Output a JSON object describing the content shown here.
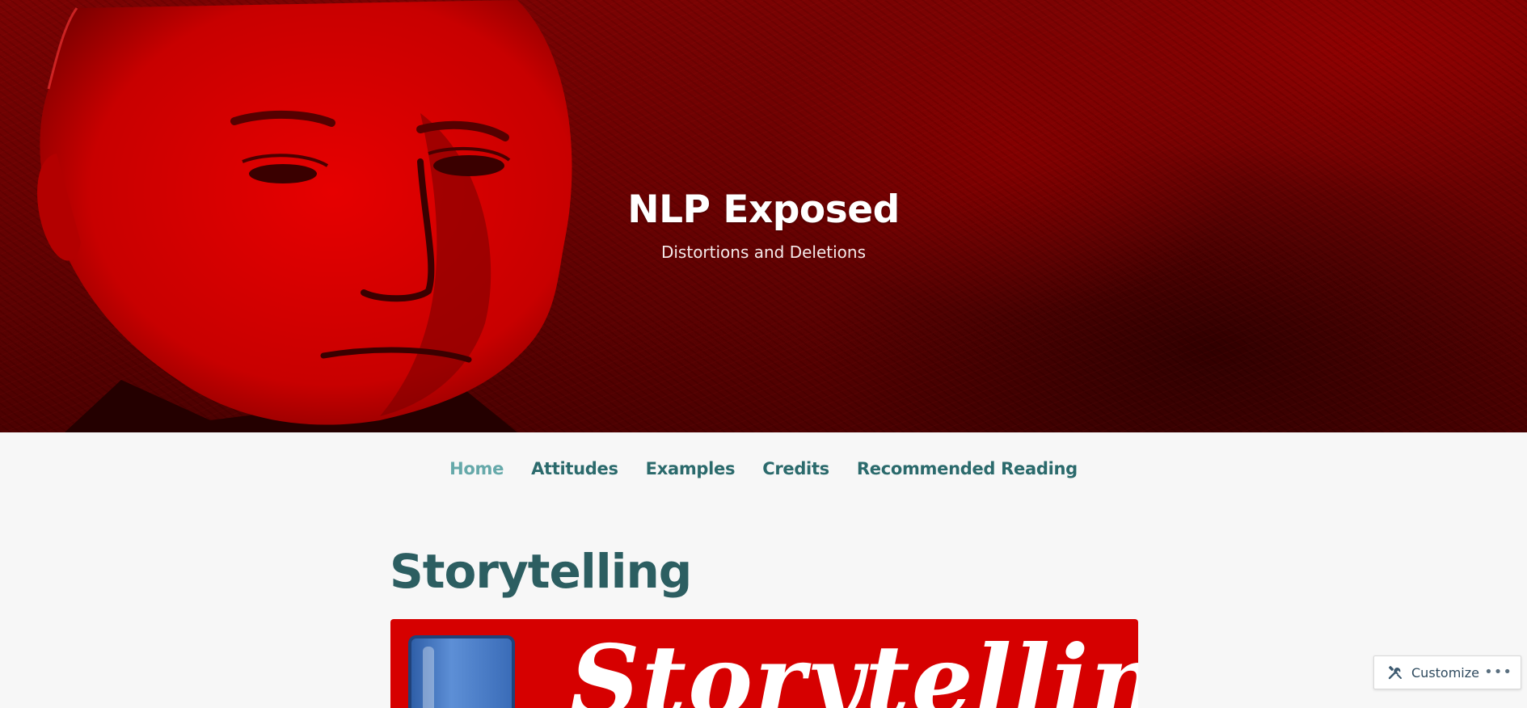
{
  "header": {
    "site_title": "NLP Exposed",
    "tagline": "Distortions and Deletions"
  },
  "nav": {
    "items": [
      {
        "label": "Home",
        "current": true
      },
      {
        "label": "Attitudes",
        "current": false
      },
      {
        "label": "Examples",
        "current": false
      },
      {
        "label": "Credits",
        "current": false
      },
      {
        "label": "Recommended Reading",
        "current": false
      }
    ]
  },
  "post": {
    "title": "Storytelling",
    "featured_image_text": "Storytelling"
  },
  "customize": {
    "label": "Customize",
    "more_label": "•••"
  },
  "colors": {
    "banner_red": "#6a0202",
    "nav_link": "#2b6a6c",
    "nav_current": "#66a9aa",
    "post_title": "#2c5e61",
    "featured_bg": "#d60000"
  },
  "icons": {
    "customize": "tools-icon",
    "more": "ellipsis-icon"
  }
}
